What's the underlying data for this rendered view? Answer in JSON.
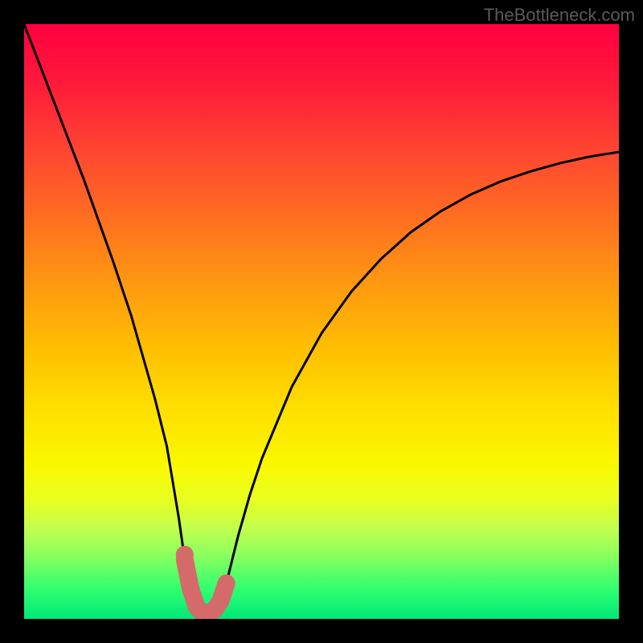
{
  "attribution": "TheBottleneck.com",
  "chart_data": {
    "type": "line",
    "title": "",
    "xlabel": "",
    "ylabel": "",
    "xlim": [
      0,
      100
    ],
    "ylim": [
      0,
      100
    ],
    "series": [
      {
        "name": "bottleneck-curve",
        "x": [
          0,
          5,
          10,
          15,
          18,
          20,
          22,
          24,
          26,
          27,
          28,
          29,
          30,
          31,
          32,
          33,
          34,
          35,
          36,
          38,
          40,
          45,
          50,
          55,
          60,
          65,
          70,
          75,
          80,
          85,
          90,
          95,
          100
        ],
        "values": [
          100,
          87,
          74,
          60,
          51,
          44,
          37,
          29,
          17,
          10,
          5,
          2,
          1,
          1,
          1.5,
          3,
          6,
          10,
          14,
          21,
          27,
          39,
          48,
          55,
          60.5,
          65,
          68.5,
          71.3,
          73.5,
          75.2,
          76.6,
          77.7,
          78.5
        ]
      },
      {
        "name": "highlight-segment",
        "x": [
          27,
          28,
          29,
          30,
          31,
          32,
          33,
          34
        ],
        "values": [
          10,
          5,
          2,
          1,
          1,
          1.5,
          3,
          6
        ]
      }
    ],
    "colors": {
      "curve": "#000000",
      "highlight": "#d46a6a"
    }
  }
}
